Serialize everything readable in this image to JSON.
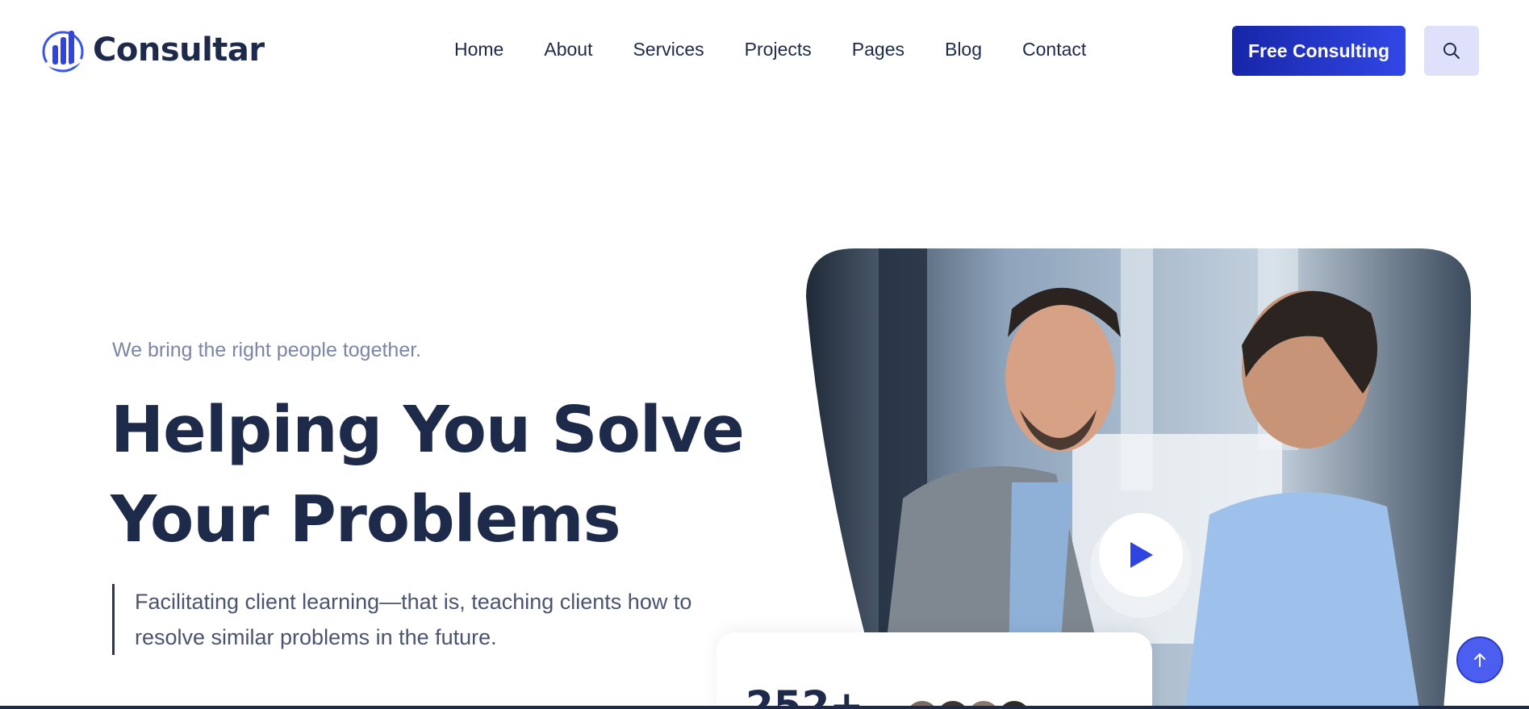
{
  "brand": {
    "name": "Consultar",
    "accent": "#2f44e0",
    "dark": "#1e2a4a"
  },
  "nav": {
    "items": [
      {
        "label": "Home"
      },
      {
        "label": "About"
      },
      {
        "label": "Services"
      },
      {
        "label": "Projects"
      },
      {
        "label": "Pages"
      },
      {
        "label": "Blog"
      },
      {
        "label": "Contact"
      }
    ]
  },
  "header": {
    "cta_label": "Free Consulting",
    "search_icon": "search-icon"
  },
  "hero": {
    "tagline": "We bring the right people together.",
    "headline_line1": "Helping You Solve",
    "headline_line2": "Your Problems",
    "quote": "Facilitating client learning—that is, teaching clients how to resolve similar problems in the future.",
    "play_icon": "play-icon"
  },
  "stats": {
    "number": "252+"
  },
  "scroll_top_icon": "arrow-up-icon"
}
